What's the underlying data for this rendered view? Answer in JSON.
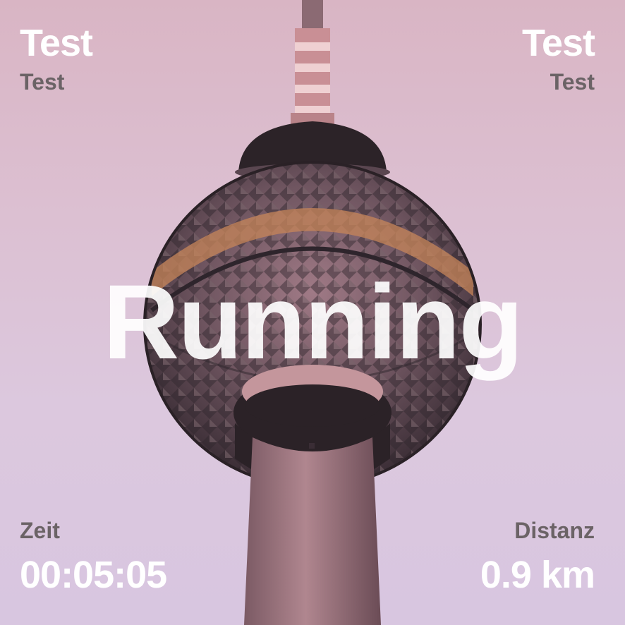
{
  "overlay": {
    "top_left": {
      "title": "Test",
      "subtitle": "Test"
    },
    "top_right": {
      "title": "Test",
      "subtitle": "Test"
    },
    "activity": "Running",
    "bottom_left": {
      "label": "Zeit",
      "value": "00:05:05"
    },
    "bottom_right": {
      "label": "Distanz",
      "value": "0.9 km"
    }
  },
  "colors": {
    "text_primary": "#ffffff",
    "text_secondary": "#6b6366",
    "sky": "#dcc4d8"
  }
}
